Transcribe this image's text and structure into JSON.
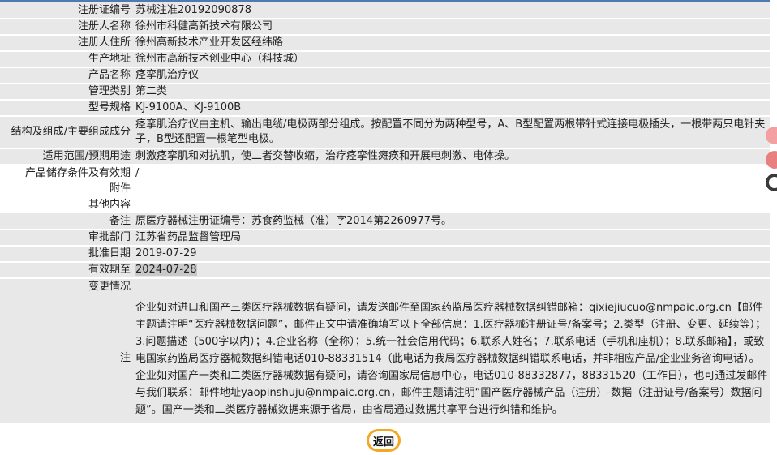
{
  "record": {
    "rows": [
      {
        "label": "注册证编号",
        "value": "苏械注准20192090878"
      },
      {
        "label": "注册人名称",
        "value": "徐州市科健高新技术有限公司"
      },
      {
        "label": "注册人住所",
        "value": "徐州高新技术产业开发区经纬路"
      },
      {
        "label": "生产地址",
        "value": "徐州市高新技术创业中心（科技城）"
      },
      {
        "label": "产品名称",
        "value": "痉挛肌治疗仪"
      },
      {
        "label": "管理类别",
        "value": "第二类"
      },
      {
        "label": "型号规格",
        "value": "KJ-9100A、KJ-9100B"
      },
      {
        "label": "结构及组成/主要组成成分",
        "value": "痉挛肌治疗仪由主机、输出电缆/电极两部分组成。按配置不同分为两种型号，A、B型配置两根带针式连接电极插头，一根带两只电针夹子，B型还配置一根笔型电极。"
      },
      {
        "label": "适用范围/预期用途",
        "value": "刺激痉挛肌和对抗肌，使二者交替收缩，治疗痉挛性瘫痪和开展电刺激、电体操。"
      },
      {
        "label": "产品储存条件及有效期",
        "value": "/"
      },
      {
        "label": "附件",
        "value": ""
      },
      {
        "label": "其他内容",
        "value": ""
      },
      {
        "label": "备注",
        "value": "原医疗器械注册证编号：苏食药监械（准）字2014第2260977号。"
      },
      {
        "label": "审批部门",
        "value": "江苏省药品监督管理局"
      },
      {
        "label": "批准日期",
        "value": "2019-07-29"
      },
      {
        "label": "有效期至",
        "value": "2024-07-28"
      },
      {
        "label": "变更情况",
        "value": ""
      }
    ],
    "note": {
      "label": "注",
      "text": "企业如对进口和国产三类医疗器械数据有疑问，请发送邮件至国家药监局医疗器械数据纠错邮箱：qixiejiucuo@nmpaic.org.cn【邮件主题请注明“医疗器械数据问题”，邮件正文中请准确填写以下全部信息：1.医疗器械注册证号/备案号；2.类型（注册、变更、延续等）；3.问题描述（500字以内）；4.企业名称（全称）；5.统一社会信用代码；6.联系人姓名；7.联系电话（手机和座机）；8.联系邮箱】，或致电国家药监局医疗器械数据纠错电话010-88331514（此电话为我局医疗器械数据纠错联系电话，并非相应产品/企业业务咨询电话）。企业如对国产一类和二类医疗器械数据有疑问，请咨询国家局信息中心，电话010-88332877，88331520（工作日），也可通过发邮件与我们联系：邮件地址yaopinshuju@nmpaic.org.cn，邮件主题请注明“国产医疗器械产品（注册）-数据（注册证号/备案号）数据问题”。国产一类和二类医疗器械数据来源于省局，由省局通过数据共享平台进行纠错和维护。"
    }
  },
  "actions": {
    "back_label": "返回"
  },
  "colors": {
    "topbar": "#4e7ab0",
    "row_odd": "#e8e8e8",
    "row_even": "#ffffff",
    "highlight": "#c8c8c8",
    "back_button": "#f5a623",
    "side_icons": [
      "#f4a0a0",
      "#e88080",
      "#3a3a3a"
    ]
  },
  "side_icons": [
    "share-icon",
    "favorite-icon",
    "top-icon"
  ]
}
